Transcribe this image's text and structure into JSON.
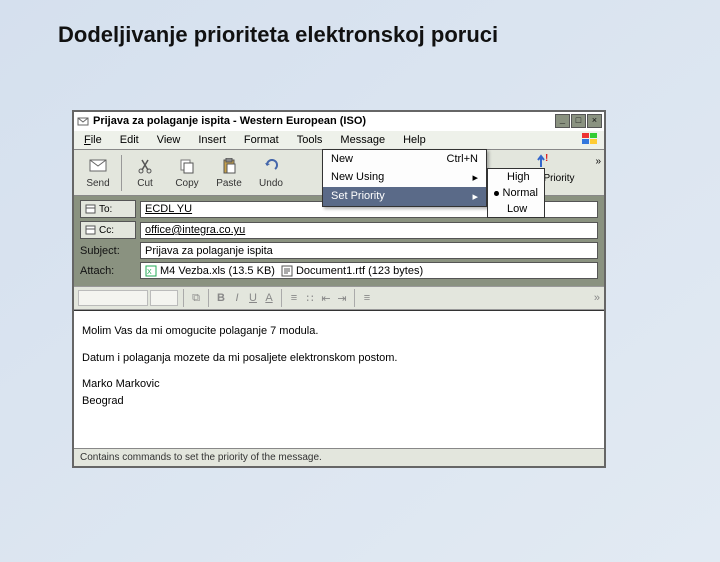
{
  "slide": {
    "title": "Dodeljivanje prioriteta elektronskoj poruci"
  },
  "window": {
    "title": "Prijava za polaganje ispita - Western European (ISO)"
  },
  "menubar": {
    "file": "File",
    "edit": "Edit",
    "view": "View",
    "insert": "Insert",
    "format": "Format",
    "tools": "Tools",
    "message": "Message",
    "help": "Help"
  },
  "toolbar": {
    "send": "Send",
    "cut": "Cut",
    "copy": "Copy",
    "paste": "Paste",
    "undo": "Undo",
    "priority": "Priority",
    "chevron": "»"
  },
  "message_menu": {
    "new": {
      "label": "New",
      "shortcut": "Ctrl+N"
    },
    "new_using": {
      "label": "New Using",
      "arrow": "▸"
    },
    "set_priority": {
      "label": "Set Priority",
      "arrow": "▸"
    }
  },
  "priority_submenu": {
    "high": "High",
    "normal": "Normal",
    "low": "Low"
  },
  "fields": {
    "to_label": "To:",
    "to_value": "ECDL YU",
    "cc_label": "Cc:",
    "cc_value": "office@integra.co.yu",
    "subject_label": "Subject:",
    "subject_value": "Prijava za polaganje ispita",
    "attach_label": "Attach:",
    "attach1": "M4 Vezba.xls (13.5 KB)",
    "attach2": "Document1.rtf (123 bytes)"
  },
  "format_bar": {
    "bold": "B",
    "italic": "I",
    "underline": "U",
    "color": "A",
    "chev": "»"
  },
  "body": {
    "line1": "Molim Vas da mi omogucite polaganje 7 modula.",
    "line2": "Datum i polaganja mozete da mi posaljete elektronskom postom.",
    "sig1": "Marko Markovic",
    "sig2": "Beograd"
  },
  "statusbar": {
    "text": "Contains commands to set the priority of the message."
  }
}
